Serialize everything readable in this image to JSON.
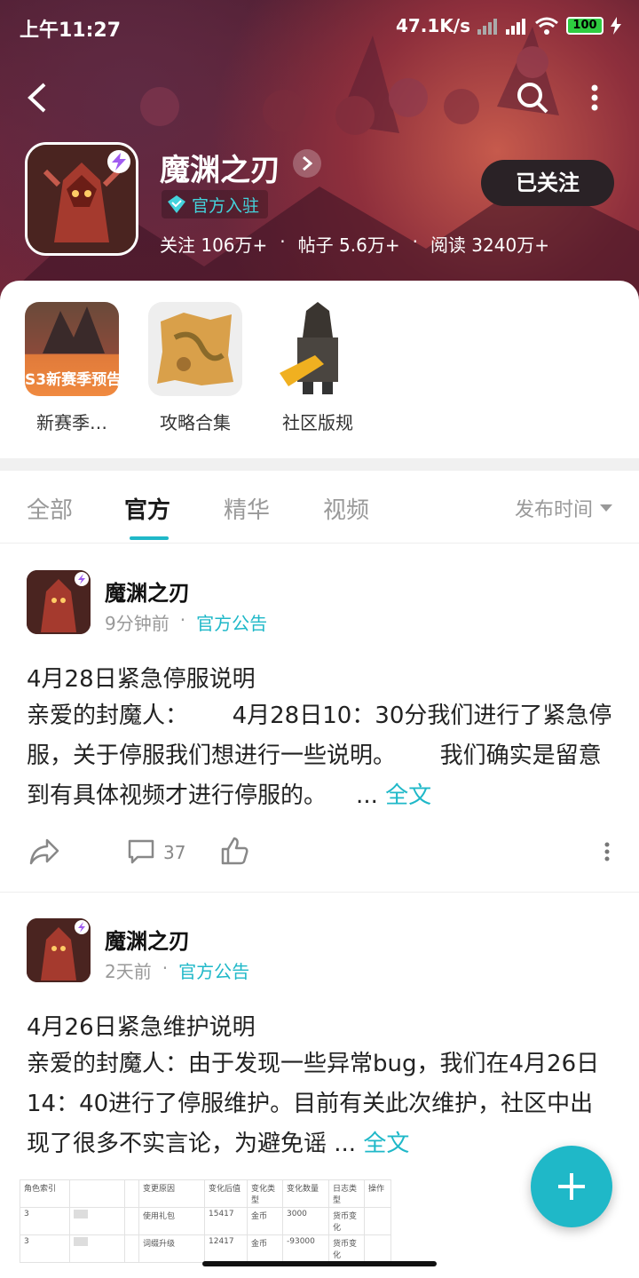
{
  "status": {
    "time": "上午11:27",
    "speed": "47.1K/s",
    "battery": "100"
  },
  "header": {
    "game_name": "魔渊之刃",
    "official_tag": "官方入驻",
    "stats": [
      "关注 106万+",
      "·",
      "帖子 5.6万+",
      "·",
      "阅读 3240万+"
    ],
    "follow_label": "已关注"
  },
  "shortcuts": [
    {
      "label": "新赛季…",
      "image_text": "S3新赛季预告"
    },
    {
      "label": "攻略合集"
    },
    {
      "label": "社区版规"
    }
  ],
  "tabs": [
    {
      "label": "全部"
    },
    {
      "label": "官方"
    },
    {
      "label": "精华"
    },
    {
      "label": "视频"
    }
  ],
  "sort_label": "发布时间",
  "posts": [
    {
      "author": "魔渊之刃",
      "time": "9分钟前",
      "dot": "·",
      "category": "官方公告",
      "title": "4月28日紧急停服说明",
      "body": "亲爱的封魔人：      4月28日10：30分我们进行了紧急停服，关于停服我们想进行一些说明。      我们确实是留意到有具体视频才进行停服的。    ... ",
      "more": "全文",
      "comments": "37"
    },
    {
      "author": "魔渊之刃",
      "time": "2天前",
      "dot": "·",
      "category": "官方公告",
      "title": "4月26日紧急维护说明",
      "body": "亲爱的封魔人：由于发现一些异常bug，我们在4月26日14：40进行了停服维护。目前有关此次维护，社区中出现了很多不实言论，为避免谣 ... ",
      "more": "全文"
    }
  ],
  "table_preview": {
    "headers": [
      "角色索引",
      "",
      "",
      "变更原因",
      "变化后值",
      "变化类型",
      "变化数量",
      "日志类型",
      "操作"
    ],
    "rows": [
      [
        "3",
        "",
        "",
        "使用礼包",
        "15417",
        "金币",
        "3000",
        "货币变化",
        ""
      ],
      [
        "3",
        "",
        "",
        "词缀升级",
        "12417",
        "金币",
        "-93000",
        "货币变化",
        ""
      ]
    ]
  },
  "colors": {
    "accent": "#1fb8c8",
    "header_bg": "#6d2336"
  }
}
